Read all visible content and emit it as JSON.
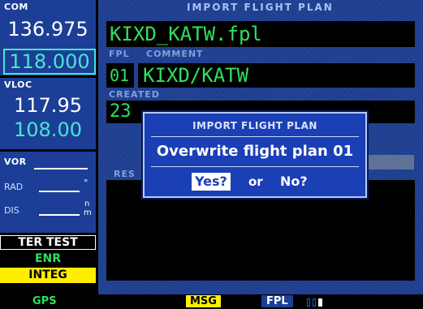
{
  "com": {
    "label": "COM",
    "active": "136.975",
    "standby": "118.000"
  },
  "vloc": {
    "label": "VLOC",
    "active": "117.95",
    "standby": "108.00"
  },
  "vor": {
    "label": "VOR",
    "rad_label": "RAD",
    "rad_unit": "°",
    "dis_label": "DIS",
    "dis_unit_top": "n",
    "dis_unit_bottom": "m"
  },
  "annunciators": {
    "ter_test": "TER TEST",
    "enr": "ENR",
    "integ": "INTEG"
  },
  "page": {
    "title": "IMPORT FLIGHT PLAN",
    "filename": "KIXD_KATW.fpl",
    "fpl_label": "FPL",
    "comment_label": "COMMENT",
    "fpl_number": "01",
    "comment_value": "KIXD/KATW",
    "created_label": "CREATED",
    "created_value": "23",
    "result_label": "RES"
  },
  "dialog": {
    "title": "IMPORT FLIGHT PLAN",
    "message": "Overwrite flight plan 01",
    "yes_label": "Yes?",
    "or_label": "or",
    "no_label": "No?"
  },
  "status_bar": {
    "gps": "GPS",
    "msg": "MSG",
    "fpl": "FPL"
  },
  "colors": {
    "panel_blue": "#1c3e96",
    "text_green": "#2fe05c",
    "standby_cyan": "#46e6d2",
    "msg_yellow": "#ffee00"
  }
}
